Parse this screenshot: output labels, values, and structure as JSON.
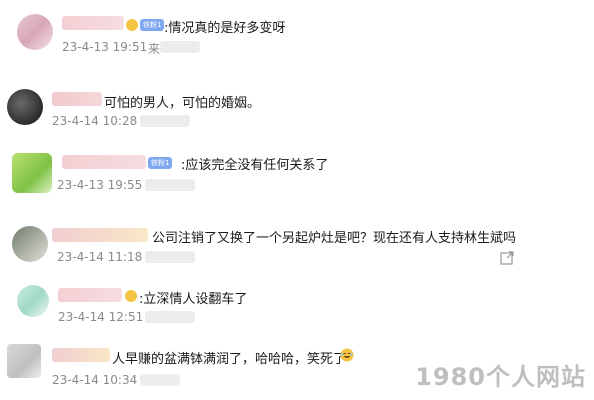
{
  "comments": [
    {
      "text": ":情况真的是好多变呀",
      "time": "23-4-13 19:51",
      "badge": "铁粉1",
      "meta_suffix": "来"
    },
    {
      "text": "可怕的男人，可怕的婚姻。",
      "time": "23-4-14 10:28",
      "badge": "",
      "meta_suffix": ""
    },
    {
      "text": ":应该完全没有任何关系了",
      "time": "23-4-13 19:55",
      "badge": "铁粉1",
      "meta_suffix": ""
    },
    {
      "text": "公司注销了又换了一个另起炉灶是吧？现在还有人支持林生斌吗",
      "time": "23-4-14 11:18",
      "badge": "",
      "meta_suffix": ""
    },
    {
      "text": ":立深情人设翻车了",
      "time": "23-4-14 12:51",
      "badge": "",
      "meta_suffix": ""
    },
    {
      "text": "人早赚的盆满钵满润了，哈哈哈，笑死了",
      "time": "23-4-14 10:34",
      "badge": "",
      "meta_suffix": ""
    }
  ],
  "watermark": "1980个人网站",
  "icons": {
    "share": "share-icon",
    "emoji": "laughing-emoji-icon"
  },
  "colors": {
    "accent_badge": "#7ea7f0",
    "meta": "#8a8a8a",
    "watermark": "#b4b4b4"
  }
}
